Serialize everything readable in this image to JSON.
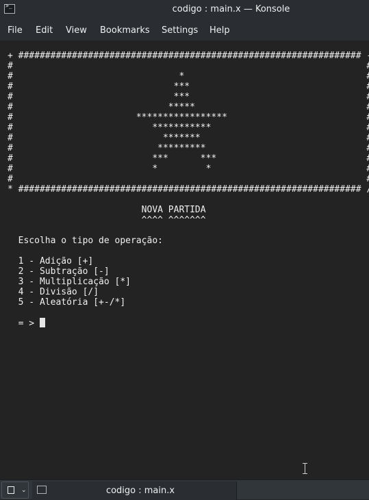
{
  "window": {
    "title": "codigo : main.x — Konsole",
    "icon": "terminal-icon"
  },
  "menu": [
    "File",
    "Edit",
    "View",
    "Bookmarks",
    "Settings",
    "Help"
  ],
  "terminal": {
    "lines": [
      "+ ################################################################ -",
      "#                                                                  #",
      "#                               *                                  #",
      "#                              ***                                 #",
      "#                              ***                                 #",
      "#                             *****                                #",
      "#                       *****************                          #",
      "#                          ***********                             #",
      "#                            *******                               #",
      "#                           *********                              #",
      "#                          ***      ***                            #",
      "#                          *         *                             #",
      "#                                                                  #",
      "* ################################################################ /",
      "",
      "                         NOVA PARTIDA",
      "                         ^^^^ ^^^^^^^",
      "",
      "  Escolha o tipo de operação:",
      "",
      "  1 - Adição [+]",
      "  2 - Subtração [-]",
      "  3 - Multiplicação [*]",
      "  4 - Divisão [/]",
      "  5 - Aleatória [+-/*]",
      ""
    ],
    "prompt": "  = > "
  },
  "tabbar": {
    "tab_label": "codigo : main.x",
    "new_tab_icon": "new-tab-icon",
    "chevron_icon": "chevron-down-icon"
  }
}
